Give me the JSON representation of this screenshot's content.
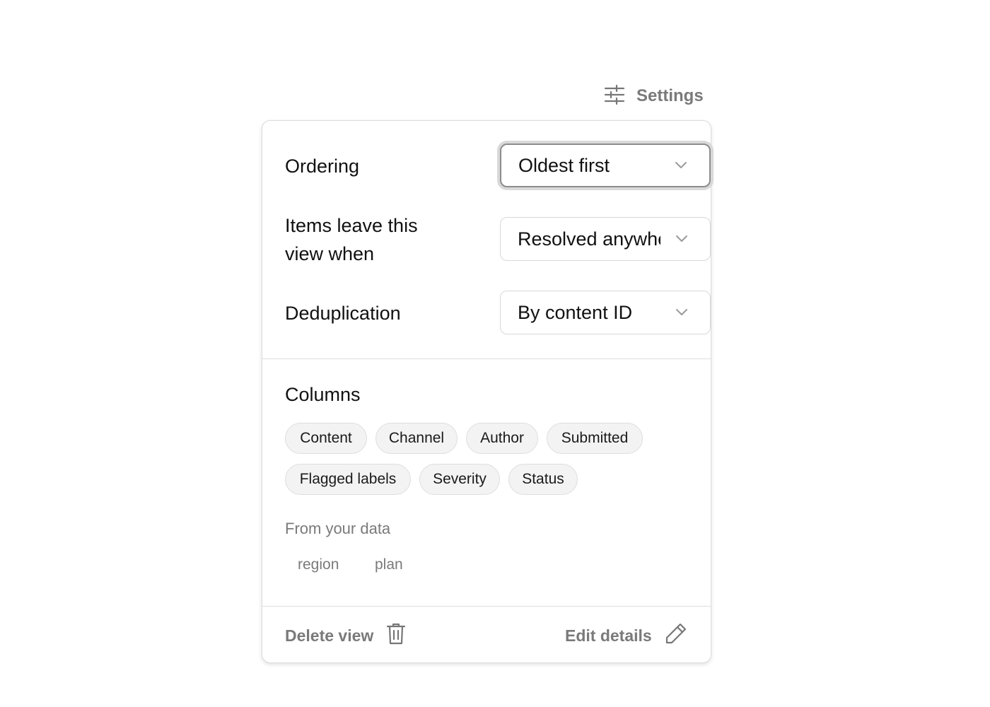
{
  "header": {
    "settings_label": "Settings",
    "settings_icon": "sliders-icon"
  },
  "settings": {
    "ordering": {
      "label": "Ordering",
      "value": "Oldest first"
    },
    "exit_condition": {
      "label": "Items leave this view when",
      "value": "Resolved anywhere"
    },
    "deduplication": {
      "label": "Deduplication",
      "value": "By content ID"
    }
  },
  "columns": {
    "title": "Columns",
    "chips": [
      "Content",
      "Channel",
      "Author",
      "Submitted",
      "Flagged labels",
      "Severity",
      "Status"
    ],
    "custom_title": "From your data",
    "custom_chips": [
      "region",
      "plan"
    ]
  },
  "footer": {
    "delete_label": "Delete view",
    "delete_icon": "trash-icon",
    "edit_label": "Edit details",
    "edit_icon": "pencil-icon"
  },
  "colors": {
    "muted_text": "#7a7a7a",
    "border": "#dcdcdc",
    "chip_bg": "#f3f3f3"
  }
}
